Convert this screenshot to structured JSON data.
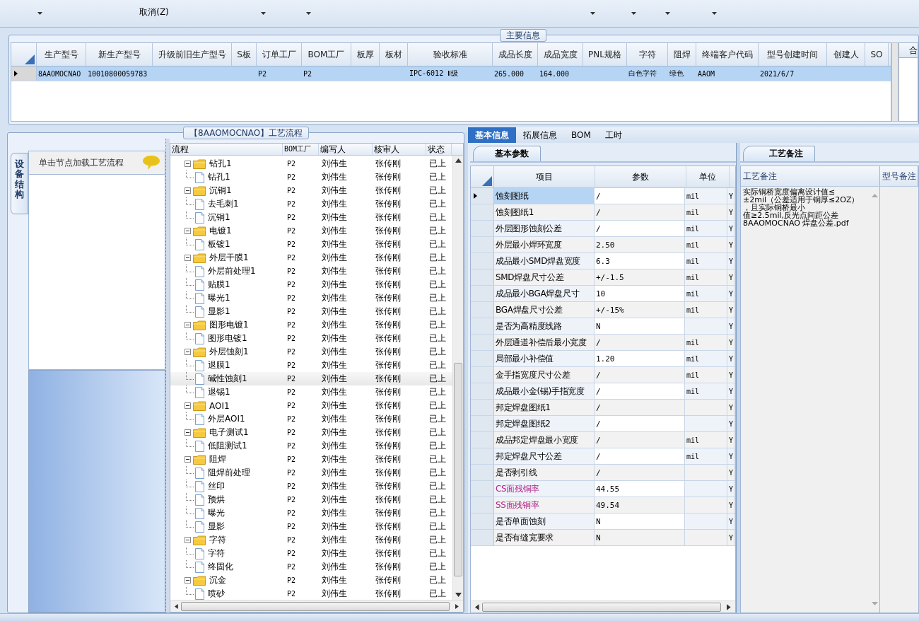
{
  "toolbar": {
    "cancel_button": "取消(Z)"
  },
  "main_info": {
    "title": "主要信息",
    "side_panel_header": "合",
    "columns": [
      "生产型号",
      "新生产型号",
      "升级前旧生产型号",
      "S板",
      "订单工厂",
      "BOM工厂",
      "板厚",
      "板材",
      "验收标准",
      "成品长度",
      "成品宽度",
      "PNL规格",
      "字符",
      "阻焊",
      "终端客户代码",
      "型号创建时间",
      "创建人",
      "SO"
    ],
    "rows": [
      {
        "selected": true,
        "cells": [
          "8AAOMOCNAO",
          "10010800059783",
          null,
          null,
          "P2",
          "P2",
          null,
          null,
          "IPC-6012 Ⅱ级",
          "265.000",
          "164.000",
          null,
          "白色字符",
          "绿色",
          "AAOM",
          "2021/6/7",
          null,
          null
        ]
      }
    ]
  },
  "process_flow": {
    "title": "【8AAOMOCNAO】工艺流程",
    "side_tab": "设备结构",
    "hint": "单击节点加载工艺流程",
    "columns": [
      "流程",
      "BOM工厂",
      "编写人",
      "核审人",
      "状态"
    ],
    "tree": [
      {
        "name": "钻孔1",
        "bom_factory": "P2",
        "writer": "刘伟生",
        "reviewer": "张传刚",
        "status": "已上",
        "expanded": true,
        "selected": false,
        "children": [
          {
            "name": "钻孔1",
            "bom_factory": "P2",
            "writer": "刘伟生",
            "reviewer": "张传刚",
            "status": "已上",
            "selected": false
          }
        ]
      },
      {
        "name": "沉铜1",
        "bom_factory": "P2",
        "writer": "刘伟生",
        "reviewer": "张传刚",
        "status": "已上",
        "expanded": true,
        "selected": false,
        "children": [
          {
            "name": "去毛刺1",
            "bom_factory": "P2",
            "writer": "刘伟生",
            "reviewer": "张传刚",
            "status": "已上",
            "selected": false
          },
          {
            "name": "沉铜1",
            "bom_factory": "P2",
            "writer": "刘伟生",
            "reviewer": "张传刚",
            "status": "已上",
            "selected": false
          }
        ]
      },
      {
        "name": "电镀1",
        "bom_factory": "P2",
        "writer": "刘伟生",
        "reviewer": "张传刚",
        "status": "已上",
        "expanded": true,
        "selected": false,
        "children": [
          {
            "name": "板镀1",
            "bom_factory": "P2",
            "writer": "刘伟生",
            "reviewer": "张传刚",
            "status": "已上",
            "selected": false
          }
        ]
      },
      {
        "name": "外层干膜1",
        "bom_factory": "P2",
        "writer": "刘伟生",
        "reviewer": "张传刚",
        "status": "已上",
        "expanded": true,
        "selected": false,
        "children": [
          {
            "name": "外层前处理1",
            "bom_factory": "P2",
            "writer": "刘伟生",
            "reviewer": "张传刚",
            "status": "已上",
            "selected": false
          },
          {
            "name": "贴膜1",
            "bom_factory": "P2",
            "writer": "刘伟生",
            "reviewer": "张传刚",
            "status": "已上",
            "selected": false
          },
          {
            "name": "曝光1",
            "bom_factory": "P2",
            "writer": "刘伟生",
            "reviewer": "张传刚",
            "status": "已上",
            "selected": false
          },
          {
            "name": "显影1",
            "bom_factory": "P2",
            "writer": "刘伟生",
            "reviewer": "张传刚",
            "status": "已上",
            "selected": false
          }
        ]
      },
      {
        "name": "图形电镀1",
        "bom_factory": "P2",
        "writer": "刘伟生",
        "reviewer": "张传刚",
        "status": "已上",
        "expanded": true,
        "selected": false,
        "children": [
          {
            "name": "图形电镀1",
            "bom_factory": "P2",
            "writer": "刘伟生",
            "reviewer": "张传刚",
            "status": "已上",
            "selected": false
          }
        ]
      },
      {
        "name": "外层蚀刻1",
        "bom_factory": "P2",
        "writer": "刘伟生",
        "reviewer": "张传刚",
        "status": "已上",
        "expanded": true,
        "selected": false,
        "children": [
          {
            "name": "退膜1",
            "bom_factory": "P2",
            "writer": "刘伟生",
            "reviewer": "张传刚",
            "status": "已上",
            "selected": false
          },
          {
            "name": "碱性蚀刻1",
            "bom_factory": "P2",
            "writer": "刘伟生",
            "reviewer": "张传刚",
            "status": "已上",
            "selected": true
          },
          {
            "name": "退锡1",
            "bom_factory": "P2",
            "writer": "刘伟生",
            "reviewer": "张传刚",
            "status": "已上",
            "selected": false
          }
        ]
      },
      {
        "name": "AOI1",
        "bom_factory": "P2",
        "writer": "刘伟生",
        "reviewer": "张传刚",
        "status": "已上",
        "expanded": true,
        "selected": false,
        "children": [
          {
            "name": "外层AOI1",
            "bom_factory": "P2",
            "writer": "刘伟生",
            "reviewer": "张传刚",
            "status": "已上",
            "selected": false
          }
        ]
      },
      {
        "name": "电子测试1",
        "bom_factory": "P2",
        "writer": "刘伟生",
        "reviewer": "张传刚",
        "status": "已上",
        "expanded": true,
        "selected": false,
        "children": [
          {
            "name": "低阻测试1",
            "bom_factory": "P2",
            "writer": "刘伟生",
            "reviewer": "张传刚",
            "status": "已上",
            "selected": false
          }
        ]
      },
      {
        "name": "阻焊",
        "bom_factory": "P2",
        "writer": "刘伟生",
        "reviewer": "张传刚",
        "status": "已上",
        "expanded": true,
        "selected": false,
        "children": [
          {
            "name": "阻焊前处理",
            "bom_factory": "P2",
            "writer": "刘伟生",
            "reviewer": "张传刚",
            "status": "已上",
            "selected": false
          },
          {
            "name": "丝印",
            "bom_factory": "P2",
            "writer": "刘伟生",
            "reviewer": "张传刚",
            "status": "已上",
            "selected": false
          },
          {
            "name": "预烘",
            "bom_factory": "P2",
            "writer": "刘伟生",
            "reviewer": "张传刚",
            "status": "已上",
            "selected": false
          },
          {
            "name": "曝光",
            "bom_factory": "P2",
            "writer": "刘伟生",
            "reviewer": "张传刚",
            "status": "已上",
            "selected": false
          },
          {
            "name": "显影",
            "bom_factory": "P2",
            "writer": "刘伟生",
            "reviewer": "张传刚",
            "status": "已上",
            "selected": false
          }
        ]
      },
      {
        "name": "字符",
        "bom_factory": "P2",
        "writer": "刘伟生",
        "reviewer": "张传刚",
        "status": "已上",
        "expanded": true,
        "selected": false,
        "children": [
          {
            "name": "字符",
            "bom_factory": "P2",
            "writer": "刘伟生",
            "reviewer": "张传刚",
            "status": "已上",
            "selected": false
          },
          {
            "name": "终固化",
            "bom_factory": "P2",
            "writer": "刘伟生",
            "reviewer": "张传刚",
            "status": "已上",
            "selected": false
          }
        ]
      },
      {
        "name": "沉金",
        "bom_factory": "P2",
        "writer": "刘伟生",
        "reviewer": "张传刚",
        "status": "已上",
        "expanded": true,
        "selected": false,
        "children": [
          {
            "name": "喷砂",
            "bom_factory": "P2",
            "writer": "刘伟生",
            "reviewer": "张传刚",
            "status": "已上",
            "selected": false
          }
        ]
      }
    ]
  },
  "detail_tabs": [
    {
      "label": "基本信息",
      "selected": true
    },
    {
      "label": "拓展信息",
      "selected": false
    },
    {
      "label": "BOM",
      "selected": false
    },
    {
      "label": "工时",
      "selected": false
    }
  ],
  "basic_params": {
    "title": "基本参数",
    "columns": [
      "项目",
      "参数",
      "单位"
    ],
    "rows": [
      {
        "item": "蚀刻图纸",
        "value": "/",
        "unit": "mil",
        "column_4": "Y",
        "selected": true,
        "flagged": false
      },
      {
        "item": "蚀刻图纸1",
        "value": "/",
        "unit": "mil",
        "column_4": "Y",
        "selected": false,
        "flagged": false
      },
      {
        "item": "外层图形蚀刻公差",
        "value": "/",
        "unit": "mil",
        "column_4": "Y",
        "selected": false,
        "flagged": false
      },
      {
        "item": "外层最小焊环宽度",
        "value": "2.50",
        "unit": "mil",
        "column_4": "Y",
        "selected": false,
        "flagged": false
      },
      {
        "item": "成品最小SMD焊盘宽度",
        "value": "6.3",
        "unit": "mil",
        "column_4": "Y",
        "selected": false,
        "flagged": false
      },
      {
        "item": "SMD焊盘尺寸公差",
        "value": "+/-1.5",
        "unit": "mil",
        "column_4": "Y",
        "selected": false,
        "flagged": false
      },
      {
        "item": "成品最小BGA焊盘尺寸",
        "value": "10",
        "unit": "mil",
        "column_4": "Y",
        "selected": false,
        "flagged": false
      },
      {
        "item": "BGA焊盘尺寸公差",
        "value": "+/-15%",
        "unit": "mil",
        "column_4": "Y",
        "selected": false,
        "flagged": false
      },
      {
        "item": "是否为高精度线路",
        "value": "N",
        "column_4": "Y",
        "selected": false,
        "flagged": false
      },
      {
        "item": "外层通道补偿后最小宽度",
        "value": "/",
        "unit": "mil",
        "column_4": "Y",
        "selected": false,
        "flagged": false
      },
      {
        "item": "局部最小补偿值",
        "value": "1.20",
        "unit": "mil",
        "column_4": "Y",
        "selected": false,
        "flagged": false
      },
      {
        "item": "金手指宽度尺寸公差",
        "value": "/",
        "unit": "mil",
        "column_4": "Y",
        "selected": false,
        "flagged": false
      },
      {
        "item": "成品最小金(锡)手指宽度",
        "value": "/",
        "unit": "mil",
        "column_4": "Y",
        "selected": false,
        "flagged": false
      },
      {
        "item": "邦定焊盘图纸1",
        "value": "/",
        "column_4": "Y",
        "selected": false,
        "flagged": false
      },
      {
        "item": "邦定焊盘图纸2",
        "value": "/",
        "column_4": "Y",
        "selected": false,
        "flagged": false
      },
      {
        "item": "成品邦定焊盘最小宽度",
        "value": "/",
        "unit": "mil",
        "column_4": "Y",
        "selected": false,
        "flagged": false
      },
      {
        "item": "邦定焊盘尺寸公差",
        "value": "/",
        "unit": "mil",
        "column_4": "Y",
        "selected": false,
        "flagged": false
      },
      {
        "item": "是否剥引线",
        "value": "/",
        "column_4": "Y",
        "selected": false,
        "flagged": false
      },
      {
        "item": "CS面残铜率",
        "value": "44.55",
        "column_4": "Y",
        "selected": false,
        "flagged": true
      },
      {
        "item": "SS面残铜率",
        "value": "49.54",
        "column_4": "Y",
        "selected": false,
        "flagged": true
      },
      {
        "item": "是否单面蚀刻",
        "value": "N",
        "column_4": "Y",
        "selected": false,
        "flagged": false
      },
      {
        "item": "是否有缝宽要求",
        "value": "N",
        "column_4": "Y",
        "selected": false,
        "flagged": false
      }
    ]
  },
  "process_notes": {
    "title": "工艺备注",
    "columns": [
      "工艺备注",
      "型号备注"
    ],
    "note_lines": [
      "实际铜桥宽度偏离设计值≤",
      "±2mil（公差适用于铜厚≤2OZ）",
      "，且实际铜桥最小",
      "值≥2.5mil,反光点间距公差",
      "8AAOMOCNAO 焊盘公差.pdf"
    ]
  }
}
